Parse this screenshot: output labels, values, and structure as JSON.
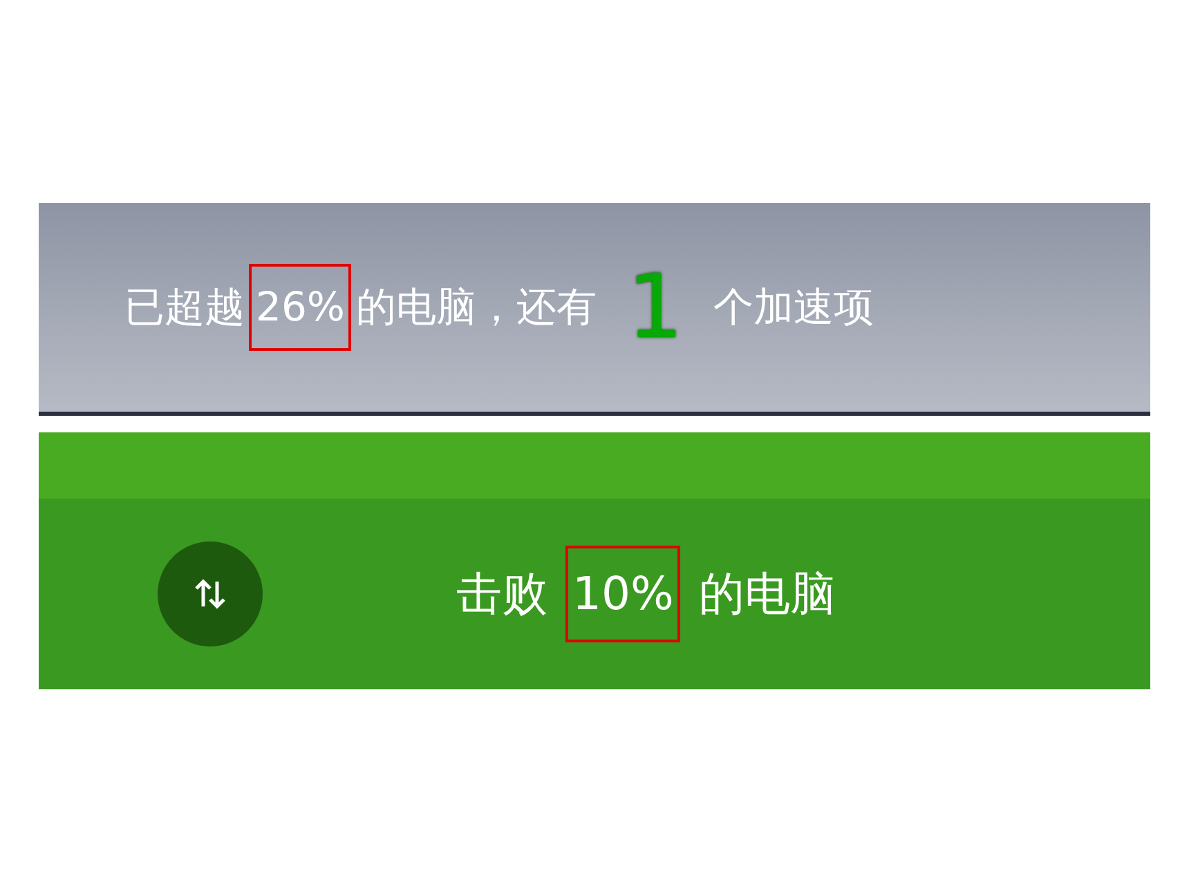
{
  "top_banner": {
    "parts": [
      {
        "text": "已超越",
        "kind": "plain"
      },
      {
        "text": "26%",
        "kind": "boxed"
      },
      {
        "text": "的电脑，还有",
        "kind": "plain"
      },
      {
        "text": "1",
        "kind": "big"
      },
      {
        "text": "个加速项",
        "kind": "plain"
      }
    ]
  },
  "bottom_banner": {
    "parts": [
      {
        "text": "击败",
        "kind": "plain"
      },
      {
        "text": "10%",
        "kind": "boxed"
      },
      {
        "text": "的电脑",
        "kind": "plain"
      }
    ]
  }
}
